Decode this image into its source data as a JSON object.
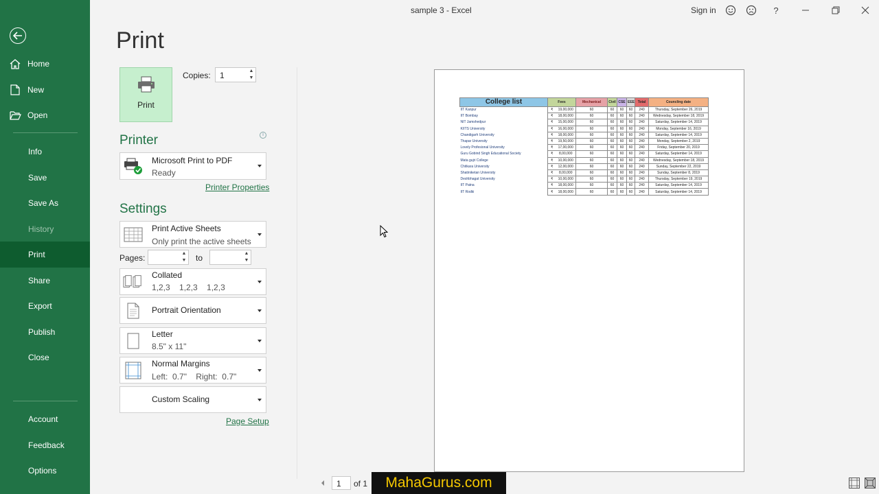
{
  "window": {
    "title": "sample 3  -  Excel",
    "sign_in": "Sign in",
    "help": "?"
  },
  "sidebar": {
    "items": [
      {
        "label": "Home",
        "icon": "home-icon"
      },
      {
        "label": "New",
        "icon": "new-document-icon"
      },
      {
        "label": "Open",
        "icon": "open-folder-icon"
      },
      {
        "label": "Info"
      },
      {
        "label": "Save"
      },
      {
        "label": "Save As"
      },
      {
        "label": "History"
      },
      {
        "label": "Print"
      },
      {
        "label": "Share"
      },
      {
        "label": "Export"
      },
      {
        "label": "Publish"
      },
      {
        "label": "Close"
      },
      {
        "label": "Account"
      },
      {
        "label": "Feedback"
      },
      {
        "label": "Options"
      }
    ],
    "selected": "Print",
    "disabled": "History"
  },
  "page": {
    "title": "Print",
    "print_button": "Print",
    "copies_label": "Copies:",
    "copies_value": "1"
  },
  "printer": {
    "heading": "Printer",
    "name": "Microsoft Print to PDF",
    "status": "Ready",
    "properties_link": "Printer Properties"
  },
  "settings": {
    "heading": "Settings",
    "what": {
      "title": "Print Active Sheets",
      "subtitle": "Only print the active sheets"
    },
    "pages_label": "Pages:",
    "to_label": "to",
    "collation": {
      "title": "Collated",
      "subtitle": "1,2,3    1,2,3    1,2,3"
    },
    "orientation": {
      "title": "Portrait Orientation"
    },
    "paper": {
      "title": "Letter",
      "subtitle": "8.5\" x 11\""
    },
    "margins": {
      "title": "Normal Margins",
      "subtitle": "Left:  0.7\"    Right:  0.7\""
    },
    "scaling": {
      "title": "Custom Scaling"
    },
    "page_setup_link": "Page Setup"
  },
  "preview": {
    "headers": [
      "College list",
      "Fees",
      "Mechanical",
      "Civil",
      "CSE",
      "EEE",
      "Total",
      "Councling date"
    ],
    "header_colors": [
      "#8ec6e6",
      "#c3d69b",
      "#e6a2a7",
      "#c3d69b",
      "#c9b3e6",
      "#d9d9d9",
      "#e26b6b",
      "#f4b183"
    ],
    "rows": [
      [
        "IIT Kanpur",
        "₹",
        "19,00,000",
        "60",
        "60",
        "60",
        "60",
        "240",
        "Thursday, September 26, 2019"
      ],
      [
        "IIT Bombay",
        "₹",
        "18,00,000",
        "60",
        "60",
        "60",
        "60",
        "240",
        "Wednesday, September 18, 2019"
      ],
      [
        "NIT Jamshedpur",
        "₹",
        "15,00,000",
        "60",
        "60",
        "60",
        "60",
        "240",
        "Saturday, September 14, 2019"
      ],
      [
        "KIITS University",
        "₹",
        "16,00,000",
        "60",
        "60",
        "60",
        "60",
        "240",
        "Monday, September 16, 2019"
      ],
      [
        "Chandigarh University",
        "₹",
        "18,00,000",
        "60",
        "60",
        "60",
        "60",
        "240",
        "Saturday, September 14, 2019"
      ],
      [
        "Thapar University",
        "₹",
        "19,50,000",
        "60",
        "60",
        "60",
        "60",
        "240",
        "Monday, September 2, 2019"
      ],
      [
        "Lovely Profesional University",
        "₹",
        "17,00,000",
        "60",
        "60",
        "60",
        "60",
        "240",
        "Friday, September 20, 2019"
      ],
      [
        "Guru Gobind Singh Educational Society",
        "₹",
        "8,00,000",
        "60",
        "60",
        "60",
        "60",
        "240",
        "Saturday, September 14, 2019"
      ],
      [
        "Mata gujri College",
        "₹",
        "10,00,000",
        "60",
        "60",
        "60",
        "60",
        "240",
        "Wednesday, September 18, 2019"
      ],
      [
        "Chitkara University",
        "₹",
        "12,00,000",
        "60",
        "60",
        "60",
        "60",
        "240",
        "Sunday, September 22, 2019"
      ],
      [
        "Shatiniketan University",
        "₹",
        "8,00,000",
        "60",
        "60",
        "60",
        "60",
        "240",
        "Sunday, September 8, 2019"
      ],
      [
        "Deshbhagat University",
        "₹",
        "10,00,000",
        "60",
        "60",
        "60",
        "60",
        "240",
        "Thursday, September 19, 2019"
      ],
      [
        "IIT Patna",
        "₹",
        "18,00,000",
        "60",
        "60",
        "60",
        "60",
        "240",
        "Saturday, September 14, 2019"
      ],
      [
        "IIT Rodki",
        "₹",
        "18,00,000",
        "60",
        "60",
        "60",
        "60",
        "240",
        "Saturday, September 14, 2019"
      ]
    ]
  },
  "pager": {
    "current": "1",
    "of_label": "of 1"
  },
  "watermark": "MahaGurus.com",
  "accent_color": "#217346"
}
